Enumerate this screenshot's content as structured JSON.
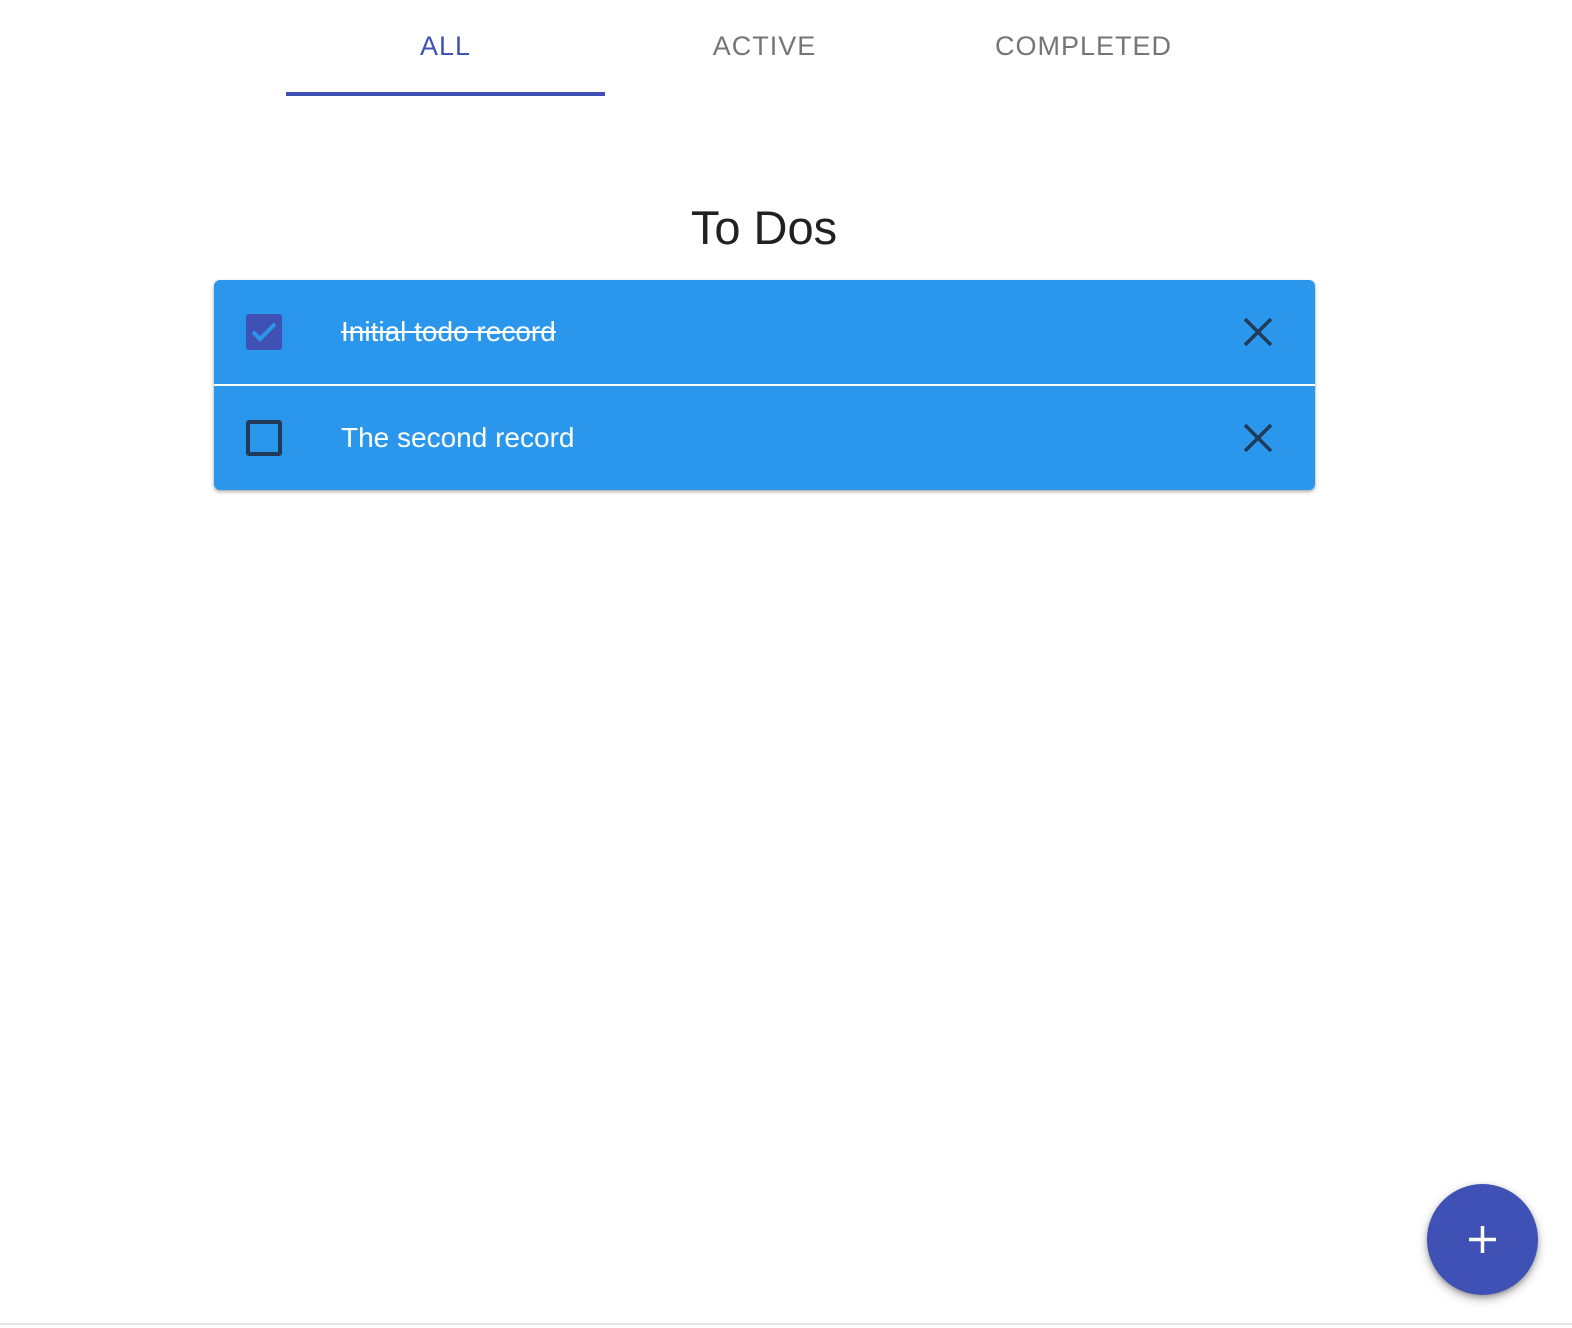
{
  "tabs": [
    {
      "label": "ALL",
      "active": true
    },
    {
      "label": "ACTIVE",
      "active": false
    },
    {
      "label": "COMPLETED",
      "active": false
    }
  ],
  "heading": "To Dos",
  "todos": [
    {
      "text": "Initial todo record",
      "completed": true
    },
    {
      "text": "The second record",
      "completed": false
    }
  ],
  "colors": {
    "primary": "#3f51b5",
    "list_background": "#2a97ec",
    "tab_inactive": "#757575",
    "icon_dark": "#213a57"
  },
  "icons": {
    "delete": "close-icon",
    "add": "plus-icon",
    "checked": "check-icon"
  }
}
